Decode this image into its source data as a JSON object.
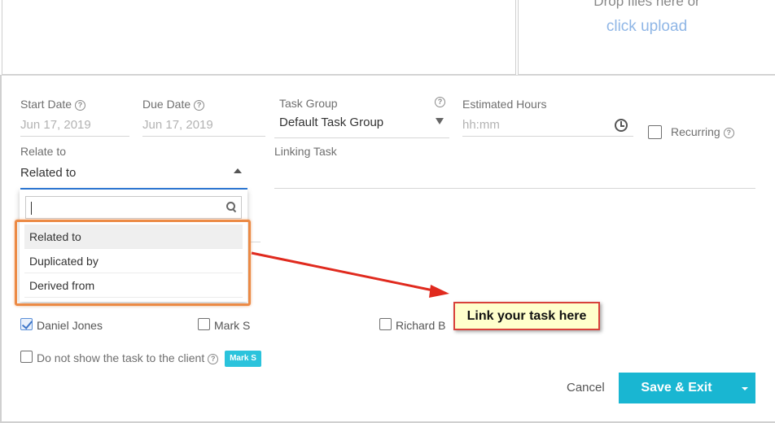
{
  "upload": {
    "drop_text": "Drop files here or",
    "click_upload": "click upload"
  },
  "fields": {
    "start_date": {
      "label": "Start Date",
      "value": "Jun 17, 2019"
    },
    "due_date": {
      "label": "Due Date",
      "value": "Jun 17, 2019"
    },
    "task_group": {
      "label": "Task Group",
      "value": "Default Task Group"
    },
    "estimated_hours": {
      "label": "Estimated Hours",
      "placeholder": "hh:mm"
    },
    "recurring": {
      "label": "Recurring",
      "checked": false
    },
    "relate_to": {
      "label": "Relate to",
      "value": "Related to"
    },
    "linking_task": {
      "label": "Linking Task"
    }
  },
  "relate_dropdown": {
    "search_value": "",
    "options": [
      "Related to",
      "Duplicated by",
      "Derived from"
    ],
    "selected": "Related to"
  },
  "callout": {
    "text": "Link your task here",
    "color": "#d8413a",
    "background": "#ffffcc"
  },
  "assignees": [
    {
      "name": "Daniel Jones",
      "checked": true
    },
    {
      "name": "Mark S",
      "checked": false
    },
    {
      "name": "Richard B",
      "checked": false
    }
  ],
  "client_visibility": {
    "label": "Do not show the task to the client",
    "checked": false,
    "badge": "Mark S"
  },
  "actions": {
    "cancel": "Cancel",
    "save_exit": "Save & Exit"
  },
  "colors": {
    "primary": "#19b6d2",
    "highlight": "#ec8a45",
    "focus": "#2f7bd9",
    "link": "#8fb6e6"
  }
}
